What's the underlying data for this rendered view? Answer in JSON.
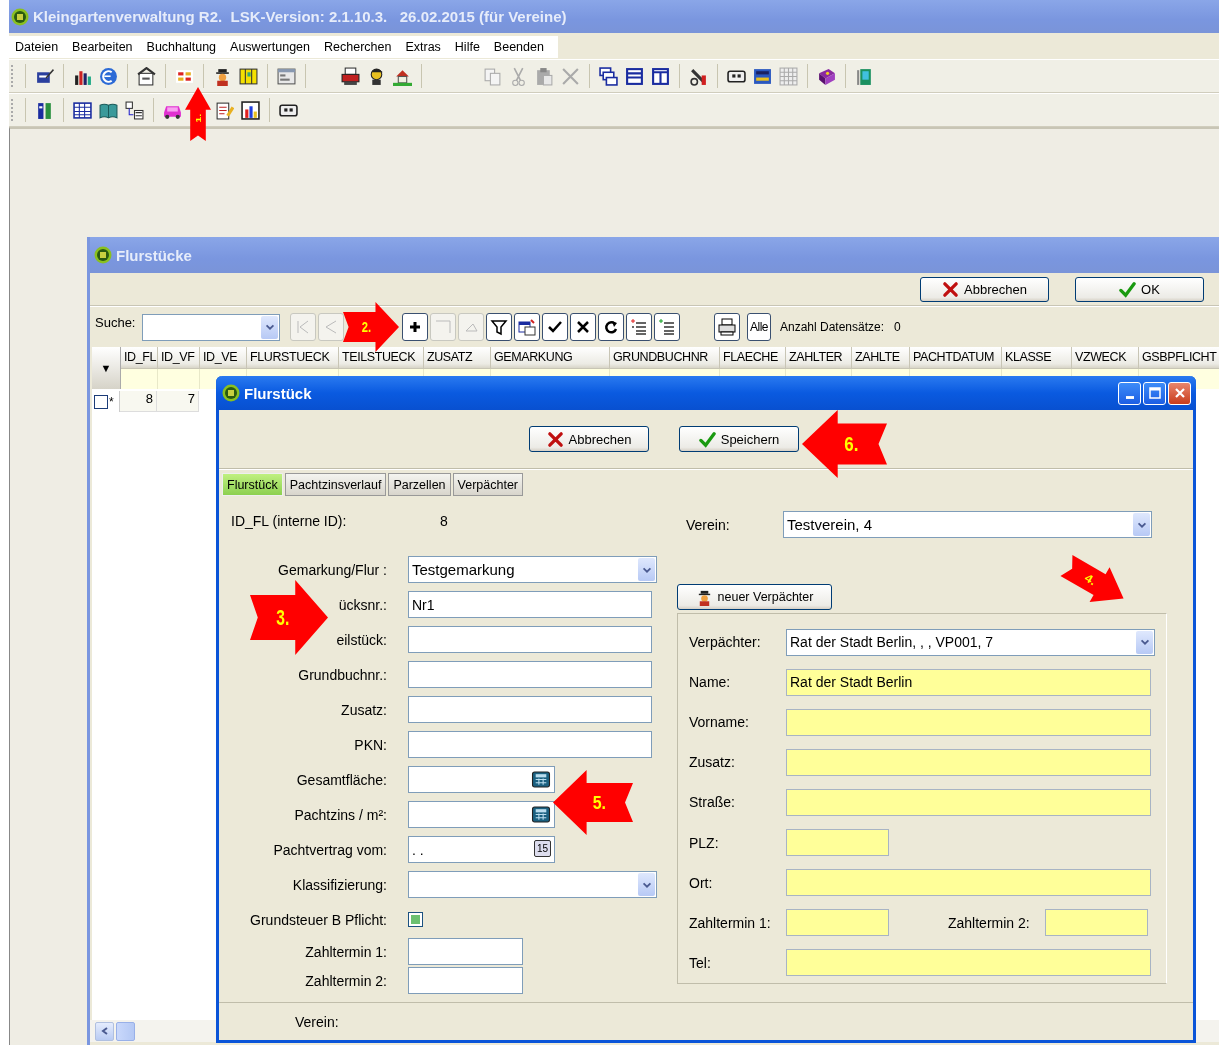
{
  "window": {
    "title": "Kleingartenverwaltung R2.  LSK-Version: 2.1.10.3.   26.02.2015 (für Vereine)"
  },
  "menu": [
    "Dateien",
    "Bearbeiten",
    "Buchhaltung",
    "Auswertungen",
    "Recherchen",
    "Extras",
    "Hilfe",
    "Beenden"
  ],
  "list_window": {
    "title": "Flurstücke",
    "buttons": [
      {
        "label": "Abbrechen",
        "kind": "cancel"
      },
      {
        "label": "OK",
        "kind": "ok"
      }
    ],
    "search_label": "Suche:",
    "all_button": "Alle",
    "count_label": "Anzahl Datensätze:",
    "count": "0",
    "selector": "▼",
    "columns": [
      "ID_FL",
      "ID_VF",
      "ID_VE",
      "FLURSTUECK",
      "TEILSTUECK",
      "ZUSATZ",
      "GEMARKUNG",
      "GRUNDBUCHNR",
      "FLAECHE",
      "ZAHLTER",
      "ZAHLTE",
      "PACHTDATUM",
      "KLASSE",
      "VZWECK",
      "GSBPFLICHT"
    ],
    "rows": [
      {
        "checked": false,
        "marker": "*",
        "cells": [
          "8",
          "7"
        ]
      }
    ]
  },
  "dialog": {
    "title": "Flurstück",
    "buttons": [
      {
        "label": "Abbrechen",
        "kind": "cancel"
      },
      {
        "label": "Speichern",
        "kind": "ok"
      }
    ],
    "tabs": [
      {
        "label": "Flurstück",
        "selected": true
      },
      {
        "label": "Pachtzinsverlauf",
        "selected": false
      },
      {
        "label": "Parzellen",
        "selected": false
      },
      {
        "label": "Verpächter",
        "selected": false
      }
    ],
    "id_label": "ID_FL (interne ID):",
    "id_value": "8",
    "fields": [
      {
        "label": "Gemarkung/Flur :",
        "kind": "combo",
        "value": "Testgemarkung"
      },
      {
        "label": "ücksnr.:",
        "kind": "text",
        "value": "Nr1"
      },
      {
        "label": "eilstück:",
        "kind": "text"
      },
      {
        "label": "Grundbuchnr.:",
        "kind": "text"
      },
      {
        "label": "Zusatz:",
        "kind": "text"
      },
      {
        "label": "PKN:",
        "kind": "text"
      },
      {
        "label": "Gesamtfläche:",
        "kind": "calc"
      },
      {
        "label": "Pachtzins / m²:",
        "kind": "calc"
      },
      {
        "label": "Pachtvertrag vom:",
        "kind": "date",
        "value": ". .",
        "button": "15"
      },
      {
        "label": "Klassifizierung:",
        "kind": "combo"
      },
      {
        "label": "Grundsteuer B Pflicht:",
        "kind": "check",
        "checked": true
      },
      {
        "label": "Zahltermin 1:",
        "kind": "short"
      },
      {
        "label": "Zahltermin 2:",
        "kind": "short"
      }
    ],
    "verein_label": "Verein:",
    "verein_value": "Testverein, 4",
    "new_lessor_button": "neuer Verpächter",
    "lessor_rows": [
      [
        {
          "label": "Verpächter:",
          "kind": "combo",
          "value": "Rat der Stadt Berlin, , , VP001, 7"
        }
      ],
      [
        {
          "label": "Name:",
          "kind": "text",
          "value": "Rat der Stadt Berlin"
        }
      ],
      [
        {
          "label": "Vorname:",
          "kind": "text"
        }
      ],
      [
        {
          "label": "Zusatz:",
          "kind": "text"
        }
      ],
      [
        {
          "label": "Straße:",
          "kind": "text"
        }
      ],
      [
        {
          "label": "PLZ:",
          "kind": "short"
        }
      ],
      [
        {
          "label": "Ort:",
          "kind": "text"
        }
      ],
      [
        {
          "label": "Zahltermin 1:",
          "kind": "short"
        },
        {
          "label": "Zahltermin 2:",
          "kind": "short"
        }
      ],
      [
        {
          "label": "Tel:",
          "kind": "text"
        }
      ]
    ],
    "footer_label": "Verein:"
  },
  "annotations": [
    {
      "label": "1.",
      "kind": "up"
    },
    {
      "label": "2.",
      "kind": "right"
    },
    {
      "label": "3.",
      "kind": "right"
    },
    {
      "label": "4.",
      "kind": "down-right"
    },
    {
      "label": "5.",
      "kind": "left"
    },
    {
      "label": "6.",
      "kind": "left"
    }
  ]
}
